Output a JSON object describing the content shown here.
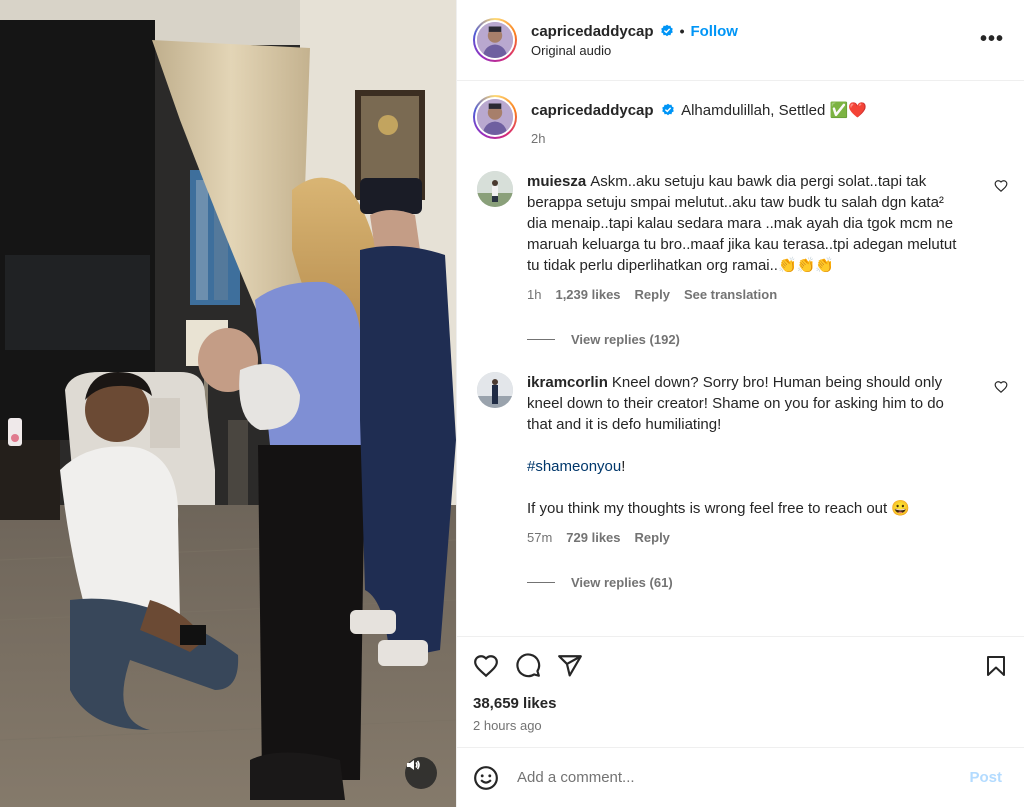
{
  "header": {
    "username": "capricedaddycap",
    "separator": "•",
    "follow_label": "Follow",
    "subtext": "Original audio",
    "more_label": "•••"
  },
  "caption": {
    "username": "capricedaddycap",
    "text": "Alhamdulillah, Settled ✅❤️",
    "time": "2h"
  },
  "comments": [
    {
      "username": "muiesza",
      "text": "Askm..aku setuju kau bawk dia pergi solat..tapi tak berappa setuju smpai melutut..aku taw budk tu salah dgn kata² dia menaip..tapi kalau sedara mara ..mak ayah dia tgok mcm ne maruah keluarga tu bro..maaf jika kau terasa..tpi adegan melutut tu tidak perlu diperlihatkan org ramai..👏👏👏",
      "time": "1h",
      "likes": "1,239 likes",
      "reply": "Reply",
      "translate": "See translation",
      "view_replies": "View replies (192)"
    },
    {
      "username": "ikramcorlin",
      "text": "Kneel down? Sorry bro! Human being should only kneel down to their creator! Shame on you for asking him to do that and it is defo humiliating!",
      "hashtag": "#shameonyou",
      "hashtag_suffix": "!",
      "text2": "If you think my thoughts is wrong feel free to reach out 😀",
      "time": "57m",
      "likes": "729 likes",
      "reply": "Reply",
      "view_replies": "View replies (61)"
    }
  ],
  "post": {
    "likes": "38,659 likes",
    "time": "2 hours ago"
  },
  "comment_box": {
    "placeholder": "Add a comment...",
    "post_label": "Post"
  },
  "icons": {
    "verified": "verified-badge-icon",
    "like": "heart-icon",
    "comment": "comment-icon",
    "share": "share-icon",
    "save": "bookmark-icon",
    "emoji": "emoji-icon",
    "audio": "speaker-icon"
  },
  "colors": {
    "accent": "#0095f6",
    "verified": "#0095f6",
    "hashtag": "#00376b",
    "post_disabled": "#b3dbff"
  }
}
